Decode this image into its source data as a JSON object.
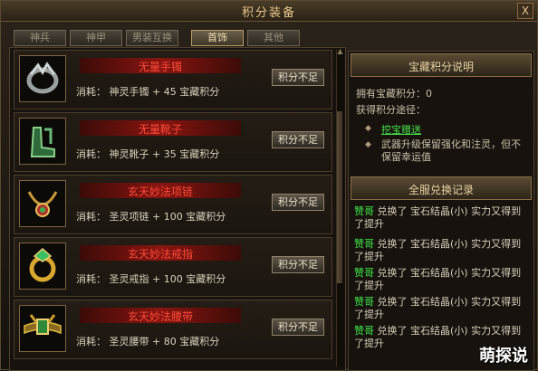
{
  "window": {
    "title": "积分装备",
    "close_label": "X"
  },
  "tabs": [
    {
      "label": "神兵"
    },
    {
      "label": "神甲"
    },
    {
      "label": "男装互换"
    },
    {
      "label": "首饰",
      "active": true
    },
    {
      "label": "其他"
    }
  ],
  "items": [
    {
      "name": "无量手镯",
      "cost": "消耗：  神灵手镯  +  45  宝藏积分",
      "button": "积分不足",
      "icon": "bracelet-icon"
    },
    {
      "name": "无量靴子",
      "cost": "消耗：  神灵靴子  +  35  宝藏积分",
      "button": "积分不足",
      "icon": "boots-icon"
    },
    {
      "name": "玄天妙法项链",
      "cost": "消耗：  圣灵项链  +  100  宝藏积分",
      "button": "积分不足",
      "icon": "necklace-icon"
    },
    {
      "name": "玄天妙法戒指",
      "cost": "消耗：  圣灵戒指  +  100  宝藏积分",
      "button": "积分不足",
      "icon": "ring-icon"
    },
    {
      "name": "玄天妙法腰带",
      "cost": "消耗：  圣灵腰带  +  80  宝藏积分",
      "button": "积分不足",
      "icon": "belt-icon"
    }
  ],
  "info": {
    "title": "宝藏积分说明",
    "points_line": "拥有宝藏积分：0",
    "ways_label": "获得积分途径：",
    "way1": "挖宝赠送",
    "way2": "武器升级保留强化和注灵，但不保留幸运值"
  },
  "log": {
    "title": "全服兑换记录",
    "entries": [
      {
        "who": "赞哥",
        "text": " 兑换了  宝石结晶(小) 实力又得到了提升"
      },
      {
        "who": "赞哥",
        "text": " 兑换了  宝石结晶(小) 实力又得到了提升"
      },
      {
        "who": "赞哥",
        "text": " 兑换了  宝石结晶(小) 实力又得到了提升"
      },
      {
        "who": "赞哥",
        "text": " 兑换了  宝石结晶(小) 实力又得到了提升"
      },
      {
        "who": "赞哥",
        "text": " 兑换了  宝石结晶(小) 实力又得到了提升"
      }
    ]
  },
  "watermark": "萌探说",
  "colors": {
    "item_name": "#ff4a3a",
    "log_user": "#3ee84a",
    "link": "#47e24a",
    "accent_gold": "#e9c98a"
  }
}
